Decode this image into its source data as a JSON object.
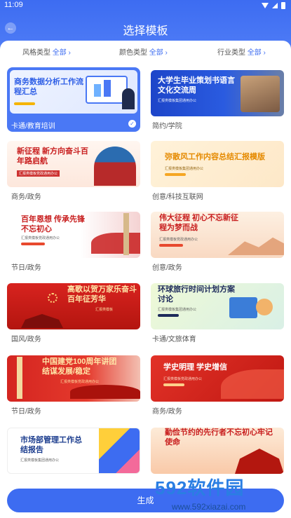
{
  "status": {
    "time": "11:09"
  },
  "header": {
    "back": "←",
    "title": "选择模板"
  },
  "filters": [
    {
      "label": "风格类型",
      "value": "全部 ›"
    },
    {
      "label": "颜色类型",
      "value": "全部 ›"
    },
    {
      "label": "行业类型",
      "value": "全部 ›"
    }
  ],
  "cards": [
    {
      "title": "商务数据分析工作流程汇总",
      "category": "卡通/教育培训",
      "selected": true
    },
    {
      "title": "大学生毕业策划书语言文化交流周",
      "sub": "汇报类模板集团通用办公",
      "category": "简约/学院"
    },
    {
      "title": "新征程 新方向奋斗百年路启航",
      "sub": "汇报类模板党政通用办公",
      "category": "商务/政务"
    },
    {
      "title": "弥散风工作内容总结汇报模版",
      "sub": "汇报类模板集团通用办公",
      "category": "创意/科技互联网"
    },
    {
      "title": "百年恩想 传承先锋不忘初心",
      "sub": "汇报类模板党政通用办公",
      "category": "节日/政务"
    },
    {
      "title": "伟大征程 初心不忘新征程为梦而战",
      "sub": "汇报类模板党政通用办公",
      "category": "创意/政务"
    },
    {
      "title": "高歌以贺万家乐奋斗百年征芳华",
      "sub": "汇报类模板",
      "category": "国风/政务"
    },
    {
      "title": "环球旅行时间计划方案讨论",
      "sub": "汇报类模板集团通用办公",
      "category": "卡通/文旅体育"
    },
    {
      "title": "中国建党100周年讲团结谋发展/稳定",
      "sub": "汇报类模板党政通用办公",
      "category": "节日/政务"
    },
    {
      "title": "学史明理 学史增信",
      "sub": "汇报类模板党政通用办公",
      "category": "商务/政务"
    },
    {
      "title": "市场部管理工作总结报告",
      "sub": "汇报类模板集团通用办公",
      "category": ""
    },
    {
      "title": "勤俭节约的先行者不忘初心牢记使命",
      "sub": "",
      "category": ""
    }
  ],
  "generate_label": "生成",
  "watermark": {
    "brand": "592软件园",
    "url": "www.592xiazai.com"
  }
}
